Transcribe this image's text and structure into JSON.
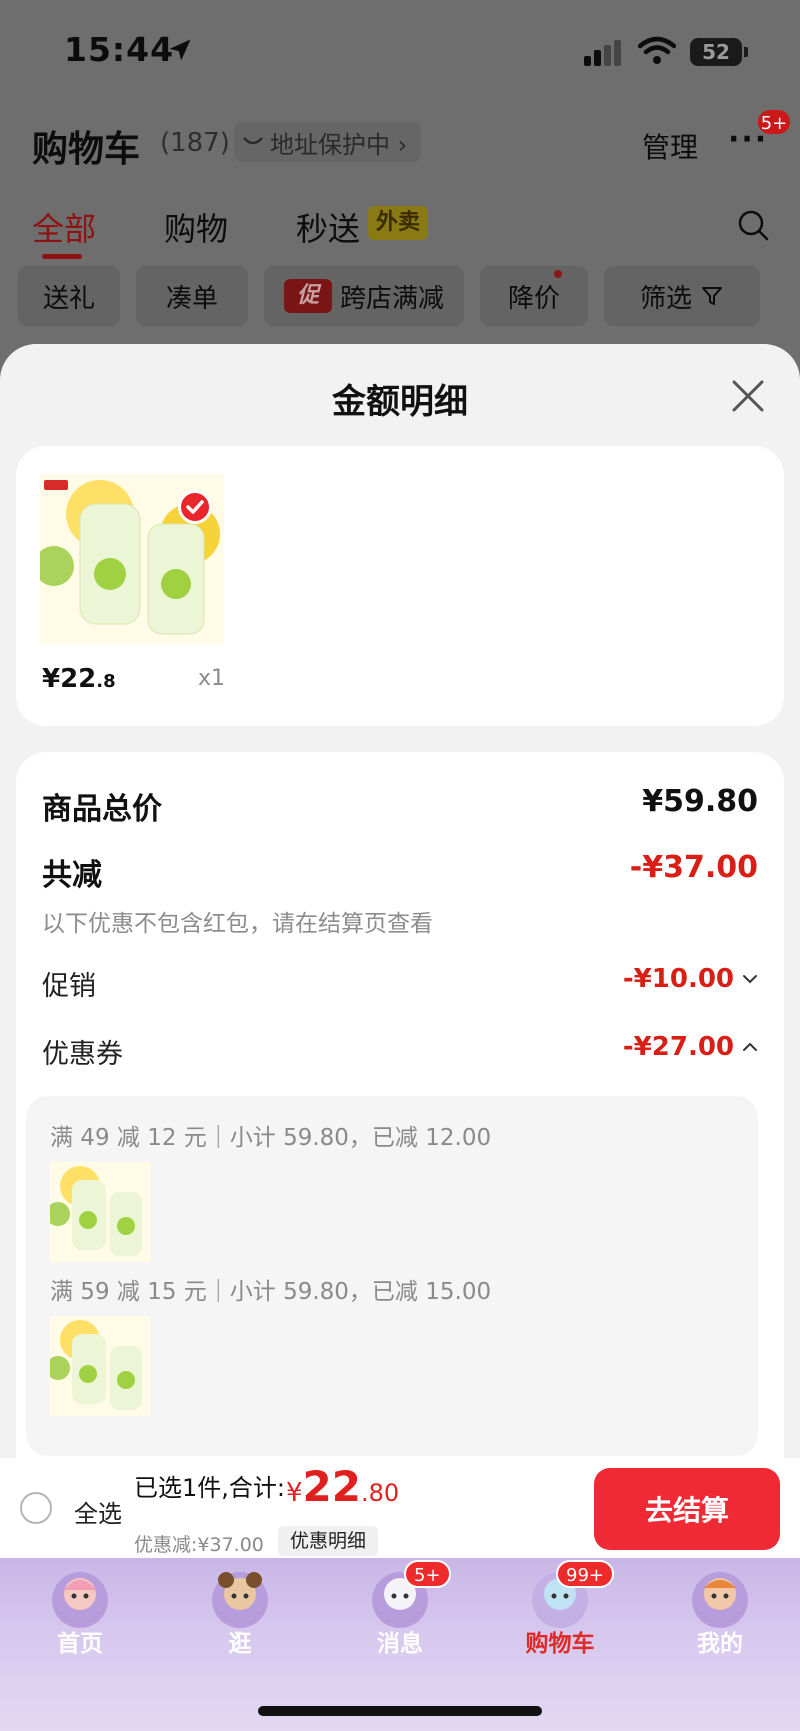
{
  "status_bar": {
    "time": "15:44",
    "battery": "52"
  },
  "cart_header": {
    "title": "购物车",
    "count": "(187)",
    "address_protection": "地址保护中 ›",
    "manage": "管理",
    "more": "···",
    "more_badge": "5+"
  },
  "tabs": [
    {
      "label": "全部"
    },
    {
      "label": "购物"
    },
    {
      "label": "秒送"
    }
  ],
  "takeout_badge": "外卖",
  "filter_chips": {
    "gift": "送礼",
    "bundle": "凑单",
    "promo_tag": "促",
    "cross_store": "跨店满减",
    "price_drop": "降价",
    "filter": "筛选"
  },
  "sheet": {
    "title": "金额明细",
    "product": {
      "price_int": "¥22",
      "price_dec": ".8",
      "qty": "x1"
    },
    "rows": {
      "total_label": "商品总价",
      "total_value": "¥59.80",
      "reduce_label": "共减",
      "reduce_value": "-¥37.00",
      "reduce_note": "以下优惠不包含红包，请在结算页查看",
      "promo_label": "促销",
      "promo_value": "-¥10.00",
      "coupon_label": "优惠券",
      "coupon_value": "-¥27.00"
    },
    "coupons": [
      {
        "text": "满 49 减 12 元｜小计 59.80，已减 12.00"
      },
      {
        "text": "满 59 减 15 元｜小计 59.80，已减 15.00"
      }
    ]
  },
  "checkout": {
    "select_all": "全选",
    "summary": "已选1件,合计:",
    "total_currency": "¥",
    "total_int": "22",
    "total_dec": ".80",
    "discount": "优惠减:¥37.00",
    "detail_chip": "优惠明细",
    "button": "去结算"
  },
  "bottom_nav": [
    {
      "label": "首页",
      "badge": ""
    },
    {
      "label": "逛",
      "badge": ""
    },
    {
      "label": "消息",
      "badge": "5+"
    },
    {
      "label": "购物车",
      "badge": "99+"
    },
    {
      "label": "我的",
      "badge": ""
    }
  ],
  "colors": {
    "accent_red": "#e0201e",
    "checkout_button": "#ef2a35",
    "sheet_background": "#f2f2f2",
    "nav_background": "#d6c7ee"
  }
}
